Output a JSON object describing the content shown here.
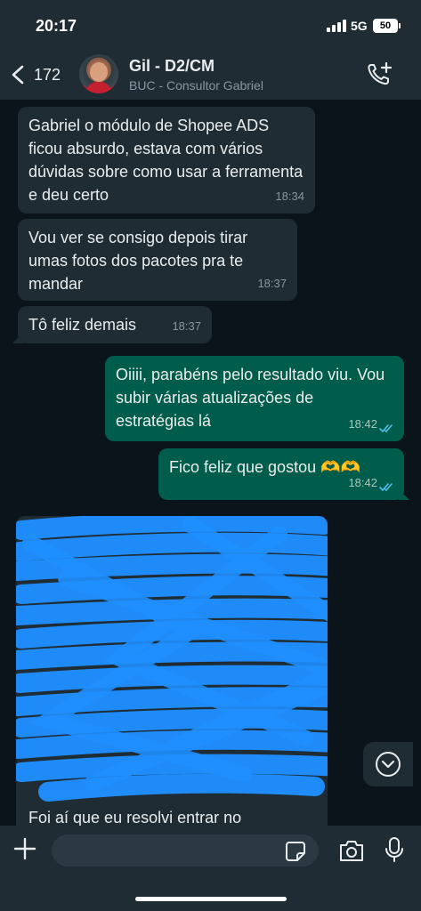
{
  "status_bar": {
    "time": "20:17",
    "network": "5G",
    "battery": "50"
  },
  "header": {
    "back_count": "172",
    "contact_name": "Gil - D2/CM",
    "contact_subtitle": "BUC - Consultor Gabriel"
  },
  "messages": [
    {
      "direction": "in",
      "text": "Gabriel o módulo de Shopee ADS ficou absurdo, estava com vários dúvidas sobre como usar a ferramenta e deu certo",
      "time": "18:34"
    },
    {
      "direction": "in",
      "text": "Vou ver se consigo depois tirar umas fotos dos pacotes pra te mandar",
      "time": "18:37"
    },
    {
      "direction": "in",
      "text": "Tô feliz demais",
      "time": "18:37"
    },
    {
      "direction": "out",
      "text": "Oiiii, parabéns pelo resultado viu. Vou subir várias atualizações de estratégias lá",
      "time": "18:42"
    },
    {
      "direction": "out",
      "text": "Fico feliz que gostou 🫶🫶",
      "time": "18:42"
    }
  ],
  "long_message": {
    "visible_text": "Foi aí que eu resolvi entrar no"
  },
  "composer": {
    "placeholder": ""
  },
  "icons": {
    "back": "chevron-left-icon",
    "call": "phone-add-icon",
    "plus": "plus-icon",
    "sticker": "sticker-icon",
    "camera": "camera-icon",
    "mic": "microphone-icon",
    "scroll": "chevron-down-circle-icon"
  },
  "colors": {
    "background": "#0b141a",
    "incoming": "#1f2c33",
    "outgoing": "#005c4b",
    "read_ticks": "#53bdeb",
    "redaction": "#1f8fff"
  }
}
